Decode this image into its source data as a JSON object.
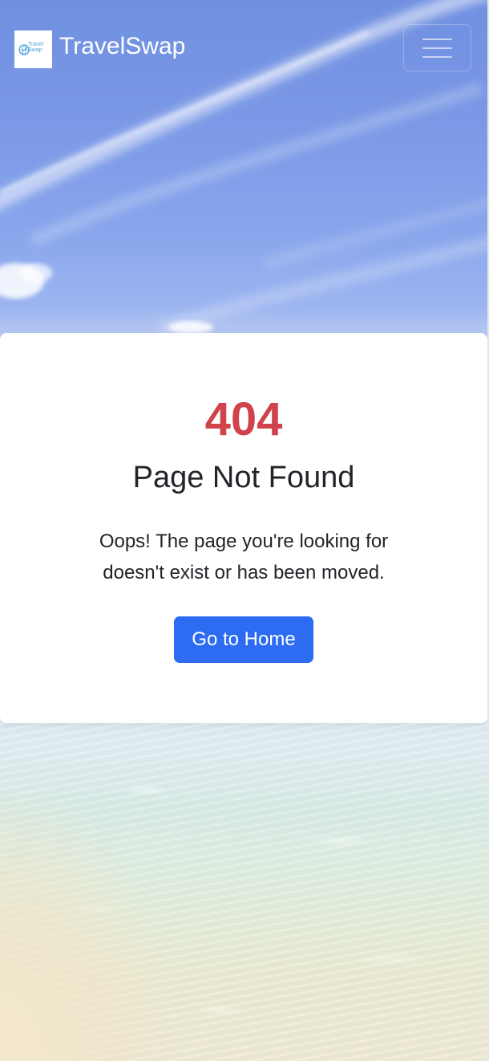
{
  "navbar": {
    "brand_name": "TravelSwap",
    "logo_text_line1": "Travel",
    "logo_text_line2": "Swap",
    "menu_icon": "hamburger-icon"
  },
  "error": {
    "code": "404",
    "title": "Page Not Found",
    "message": "Oops! The page you're looking for doesn't exist or has been moved.",
    "button_label": "Go to Home"
  },
  "colors": {
    "accent": "#2d6cf2",
    "error": "#d0434c",
    "text": "#212529",
    "card_bg": "#ffffff"
  }
}
